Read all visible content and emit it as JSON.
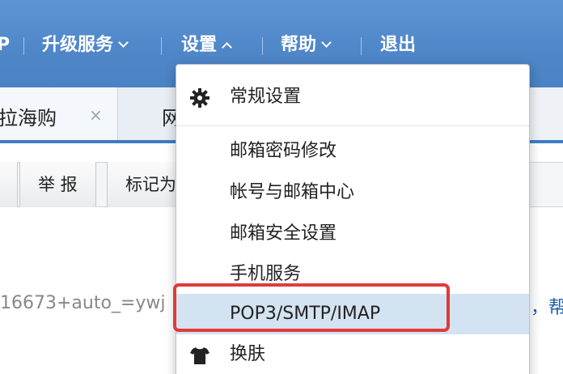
{
  "topnav": {
    "partial_left": "P",
    "upgrade": "升级服务",
    "settings": "设置",
    "help": "帮助",
    "logout": "退出"
  },
  "tabs": [
    {
      "label": "拉海购",
      "close": "×"
    },
    {
      "label": "网"
    }
  ],
  "toolbar": {
    "report": "举 报",
    "mark": "标记为"
  },
  "content": {
    "text_fragment": "16673+auto_=ywj",
    "link_fragment": "，帮"
  },
  "settings_menu": {
    "general": "常规设置",
    "change_password": "邮箱密码修改",
    "account_center": "帐号与邮箱中心",
    "security": "邮箱安全设置",
    "mobile": "手机服务",
    "pop3": "POP3/SMTP/IMAP",
    "skin": "换肤",
    "icons": {
      "general": "gear-icon",
      "skin": "tshirt-icon"
    }
  },
  "colors": {
    "topbar": "#4f87c9",
    "selected_row": "#d4e3f1",
    "highlight": "#e03a3a",
    "link": "#1e5fa8"
  }
}
